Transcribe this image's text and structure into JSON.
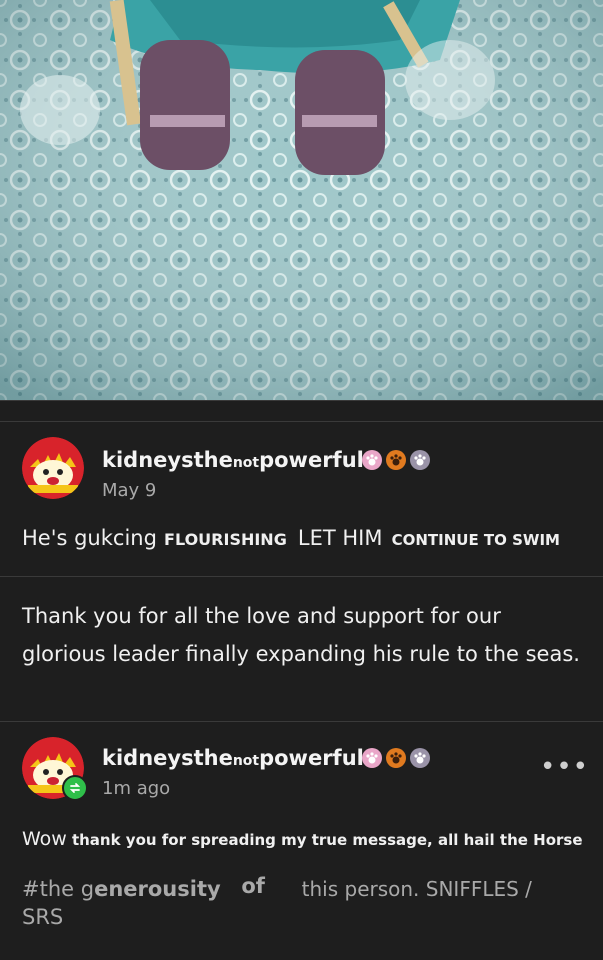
{
  "post1": {
    "username_part1": "kidneysthe",
    "username_small": "not",
    "username_part2": "powerful",
    "date": "May 9",
    "text_a": "He's gukcing",
    "text_b": "FLOURISHING",
    "text_c": "LET HIM",
    "text_d": "CONTINUE TO SWIM",
    "body": "Thank you for all the love and support for our glorious leader finally expanding his rule to the seas."
  },
  "post2": {
    "username_part1": "kidneysthe",
    "username_small": "not",
    "username_part2": "powerful",
    "time": "1m ago",
    "message_w": "Wow",
    "message_rest": "thank you for spreading my true message, all hail the Horse",
    "tag_a": "#the g",
    "tag_b": "enerousity",
    "tag_c": "of",
    "tag_d": "this person. SNIFFLES /",
    "tag_e": "SRS"
  },
  "colors": {
    "background": "#1e1e1e",
    "reblog_green": "#2fbf4a",
    "avatar_red": "#d8232b",
    "badge_pink": "#e9a6c8",
    "badge_orange": "#e07a1f",
    "badge_gray": "#9a93a8"
  },
  "icons": [
    "reblog-icon",
    "more-options-icon",
    "paw-badge-icon"
  ]
}
